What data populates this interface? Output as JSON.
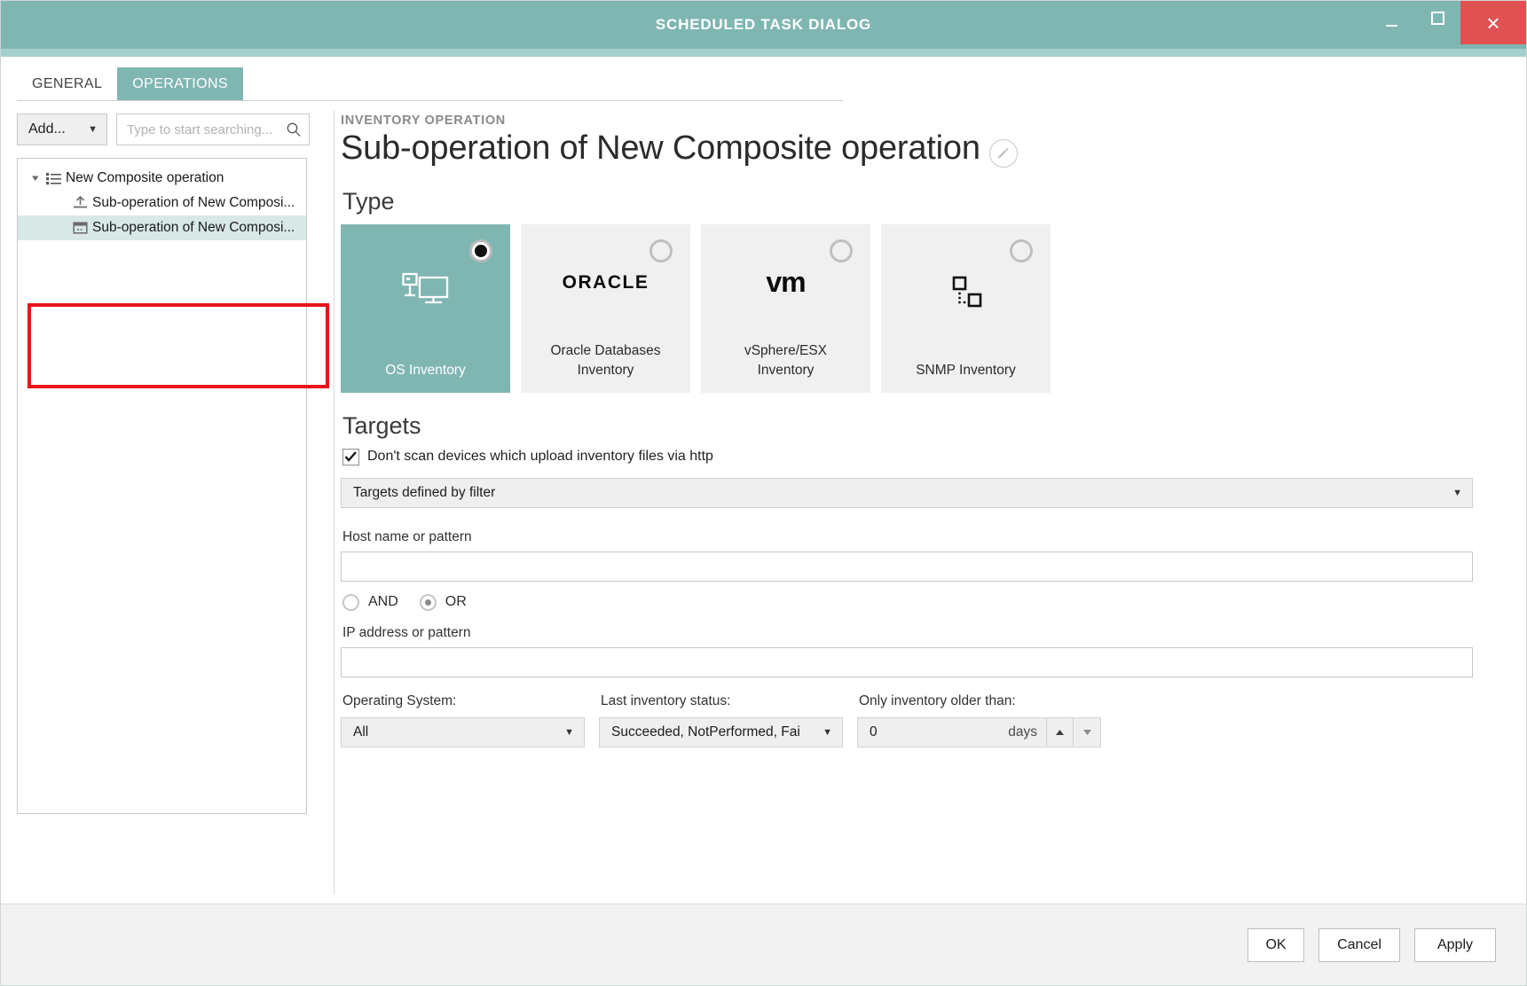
{
  "window": {
    "title": "SCHEDULED TASK DIALOG",
    "accent_color": "#7fb6b2",
    "close_color": "#e05252",
    "highlight_color": "#e8151a",
    "minimize_label": "Minimize",
    "maximize_label": "Maximize",
    "close_label": "×"
  },
  "tabs": [
    {
      "label": "GENERAL",
      "active": false
    },
    {
      "label": "OPERATIONS",
      "active": true
    }
  ],
  "left_panel": {
    "add_button": {
      "label": "Add...",
      "icon": "chevron-down-icon"
    },
    "search": {
      "placeholder": "Type to start searching...",
      "value": "",
      "icon": "search-icon"
    },
    "tree": [
      {
        "label": "New Composite operation",
        "icon": "list-icon",
        "level": 0,
        "expanded": true,
        "selected": false
      },
      {
        "label": "Sub-operation of New Composi...",
        "icon": "upload-icon",
        "level": 1,
        "selected": false
      },
      {
        "label": "Sub-operation of New Composi...",
        "icon": "inventory-box-icon",
        "level": 1,
        "selected": true
      }
    ]
  },
  "detail": {
    "kicker": "INVENTORY OPERATION",
    "title": "Sub-operation of New Composite operation",
    "edit_icon": "pencil-icon",
    "type_section": {
      "heading": "Type",
      "tiles": [
        {
          "label": "OS Inventory",
          "glyph": "os-inventory-icon",
          "selected": true
        },
        {
          "label": "Oracle Databases\nInventory",
          "glyph": "oracle-logo",
          "glyph_text": "ORACLE",
          "selected": false
        },
        {
          "label": "vSphere/ESX\nInventory",
          "glyph": "vmware-logo",
          "glyph_text": "vm",
          "selected": false
        },
        {
          "label": "SNMP Inventory",
          "glyph": "snmp-icon",
          "selected": false
        }
      ]
    },
    "targets_section": {
      "heading": "Targets",
      "no_http_scan": {
        "label": "Don't scan devices which upload inventory files via http",
        "checked": true
      },
      "target_mode": {
        "value": "Targets defined by filter",
        "icon": "chevron-down-icon"
      },
      "host_label": "Host name or pattern",
      "host_value": "",
      "logic": {
        "and_label": "AND",
        "or_label": "OR",
        "selected": "OR"
      },
      "ip_label": "IP address or pattern",
      "ip_value": "",
      "os_label": "Operating System:",
      "os_value": "All",
      "status_label": "Last inventory status:",
      "status_value": "Succeeded, NotPerformed, Fai",
      "age_label": "Only inventory older than:",
      "age_value": "0",
      "age_unit": "days"
    }
  },
  "footer": {
    "ok": "OK",
    "cancel": "Cancel",
    "apply": "Apply"
  }
}
